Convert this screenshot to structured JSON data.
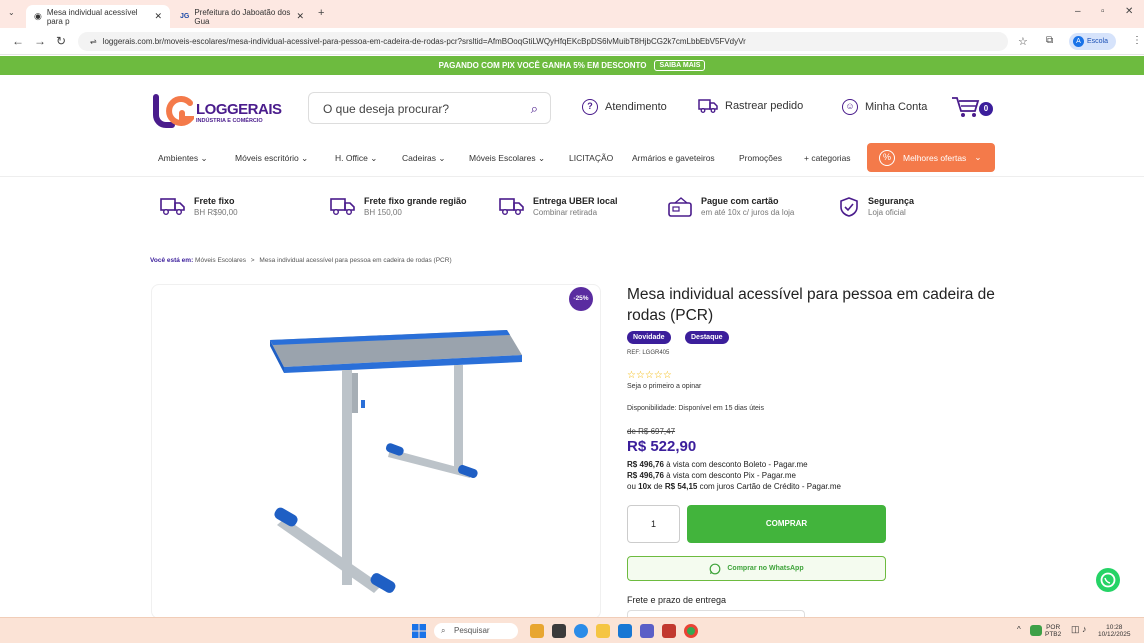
{
  "browser": {
    "tabs": [
      {
        "title": "Mesa individual acessível para p",
        "active": true
      },
      {
        "title": "Prefeitura do Jaboatão dos Gua",
        "active": false
      }
    ],
    "new_tab": "+",
    "url": "loggerais.com.br/moveis-escolares/mesa-individual-acessivel-para-pessoa-em-cadeira-de-rodas-pcr?srsltid=AfmBOoqGtiLWQyHfqEKcBpDS6lvMuibT8HjbCG2k7cmLbbEbV5FVdyVr",
    "profile": {
      "initial": "A",
      "label": "Escola"
    }
  },
  "promo": {
    "text": "PAGANDO COM PIX VOCÊ GANHA 5% EM DESCONTO",
    "button": "SAIBA MAIS"
  },
  "header": {
    "logo_text": "LOGGERAIS",
    "logo_sub": "INDÚSTRIA E COMÉRCIO",
    "search_placeholder": "O que deseja procurar?",
    "links": {
      "support": "Atendimento",
      "track": "Rastrear pedido",
      "account": "Minha Conta"
    },
    "cart_count": "0"
  },
  "nav": {
    "items": [
      "Ambientes",
      "Móveis escritório",
      "H. Office",
      "Cadeiras",
      "Móveis Escolares",
      "LICITAÇÃO",
      "Armários e gaveteiros",
      "Promoções",
      "+ categorias"
    ],
    "offers": "Melhores ofertas"
  },
  "benefits": [
    {
      "title": "Frete fixo",
      "subtitle": "BH R$90,00",
      "icon": "truck-icon"
    },
    {
      "title": "Frete fixo grande região",
      "subtitle": "BH 150,00",
      "icon": "truck-icon"
    },
    {
      "title": "Entrega UBER local",
      "subtitle": "Combinar retirada",
      "icon": "truck-icon"
    },
    {
      "title": "Pague com cartão",
      "subtitle": "em até 10x c/ juros da loja",
      "icon": "card-icon"
    },
    {
      "title": "Segurança",
      "subtitle": "Loja oficial",
      "icon": "shield-icon"
    }
  ],
  "breadcrumb": {
    "lead": "Você está em:",
    "parent": "Móveis Escolares",
    "sep": ">",
    "current": "Mesa individual acessível para pessoa em cadeira de rodas (PCR)"
  },
  "product": {
    "discount": "-25%",
    "title": "Mesa individual acessível para pessoa em cadeira de rodas (PCR)",
    "badges": [
      "Novidade",
      "Destaque"
    ],
    "ref": "REF: LGGR405",
    "stars": "☆☆☆☆☆",
    "rating_count": 0,
    "opinion": "Seja o primeiro a opinar",
    "availability_label": "Disponibilidade:",
    "availability": "Disponível em 15 dias úteis",
    "old_price": "de R$ 697,47",
    "price": "R$ 522,90",
    "boleto_value": "R$ 496,76",
    "boleto_text": "à vista com desconto Boleto - Pagar.me",
    "pix_value": "R$ 496,76",
    "pix_text": "à vista com desconto Pix - Pagar.me",
    "installment_pre": "ou",
    "installment_count": "10x",
    "installment_mid": "de",
    "installment_value": "R$ 54,15",
    "installment_text": "com juros Cartão de Crédito - Pagar.me",
    "quantity": "1",
    "buy_label": "COMPRAR",
    "whatsapp_label": "Comprar no WhatsApp",
    "shipping_label": "Frete e prazo de entrega"
  },
  "colors": {
    "brand_purple": "#3b1e9b",
    "promo_green": "#6dbb3f",
    "buy_green": "#42b43c",
    "offers_orange": "#f47a4a"
  },
  "taskbar": {
    "search_placeholder": "Pesquisar",
    "lang": "POR",
    "lang_sub": "PTB2",
    "time": "10:28",
    "date": "10/12/2025"
  }
}
